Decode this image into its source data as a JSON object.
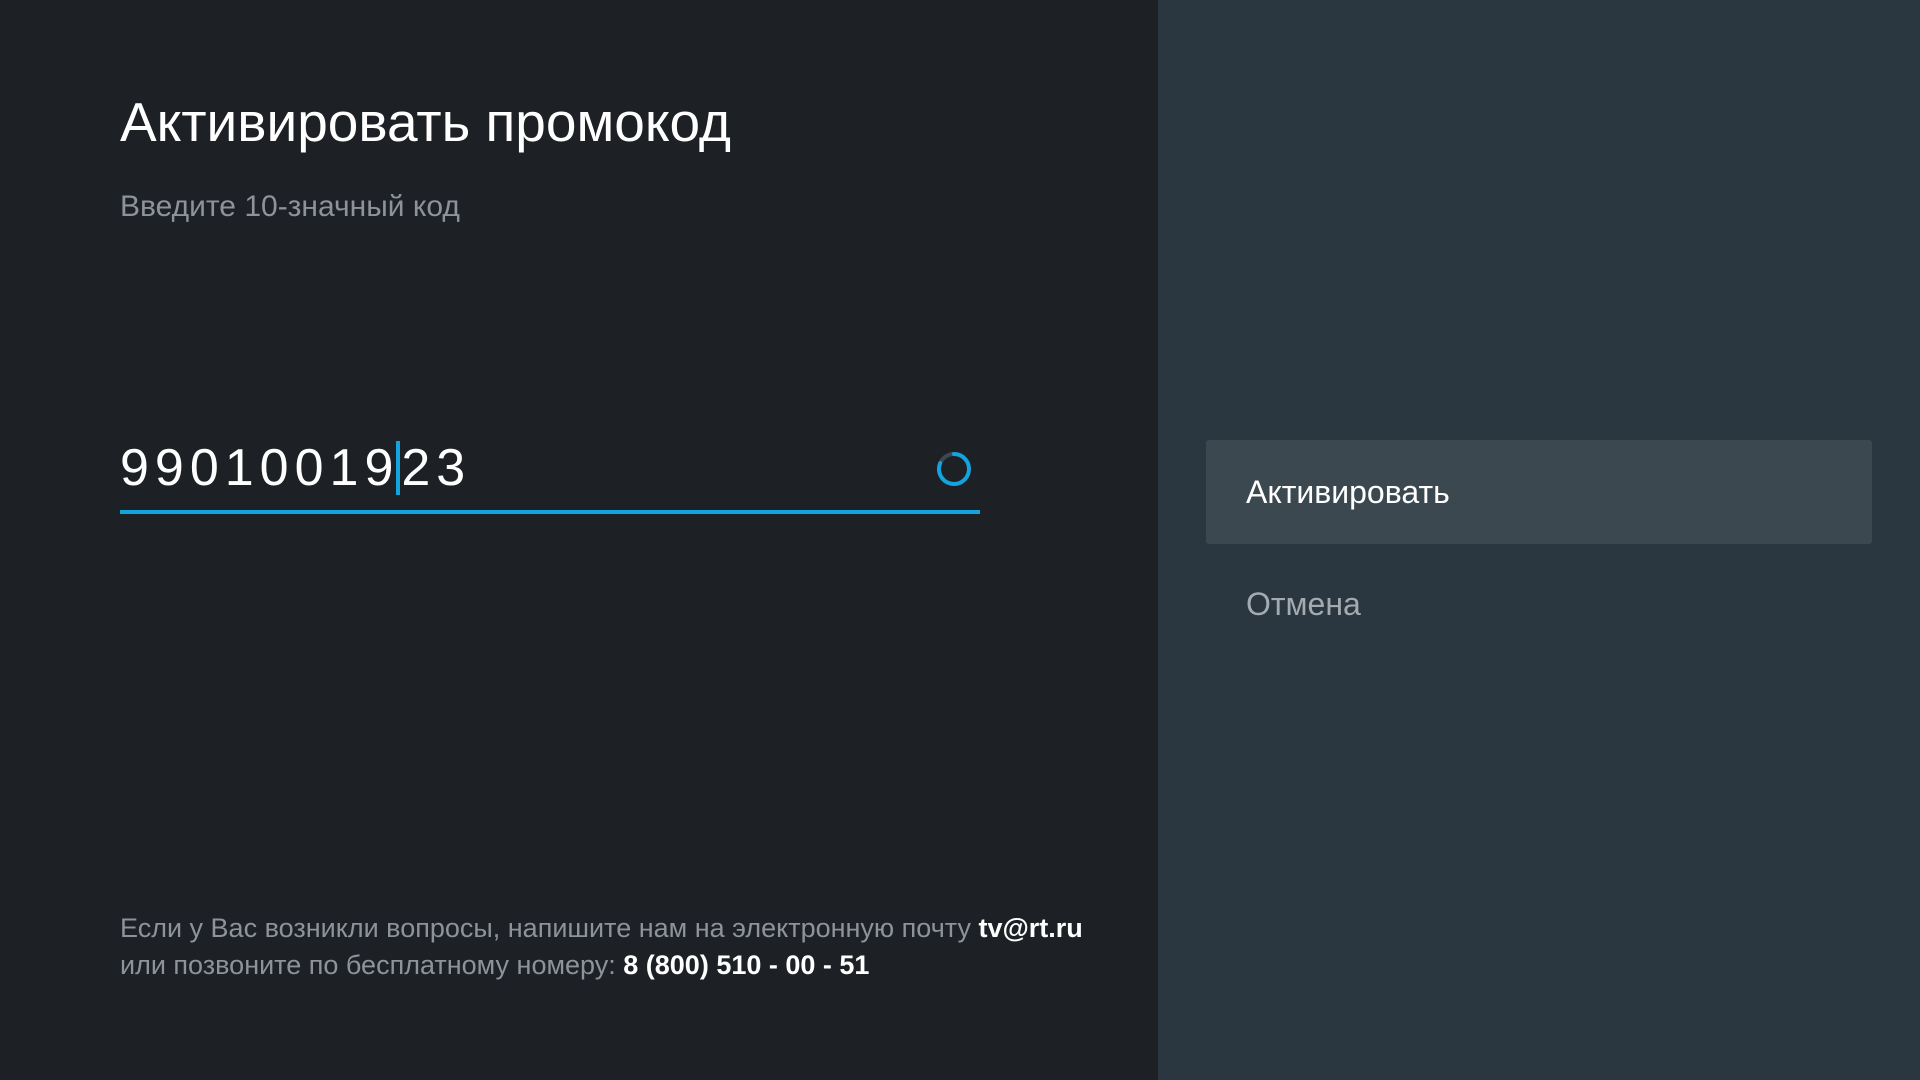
{
  "dialog": {
    "title": "Активировать промокод",
    "subtitle": "Введите 10-значный код"
  },
  "code_input": {
    "value_before_caret": "99010019",
    "value_after_caret": "23",
    "loading_indicator": "spinner-icon"
  },
  "footer": {
    "line1_text": "Если у Вас возникли вопросы, напишите нам на электронную почту ",
    "email": "tv@rt.ru",
    "line2_text": "или позвоните по бесплатному номеру: ",
    "phone": "8 (800) 510 - 00 - 51"
  },
  "actions": {
    "activate_label": "Активировать",
    "cancel_label": "Отмена"
  },
  "colors": {
    "left_background": "#1d2126",
    "right_background": "#2a3640",
    "accent": "#13a3dd",
    "selected_item": "#3c4850",
    "secondary_text": "#8e9399"
  }
}
